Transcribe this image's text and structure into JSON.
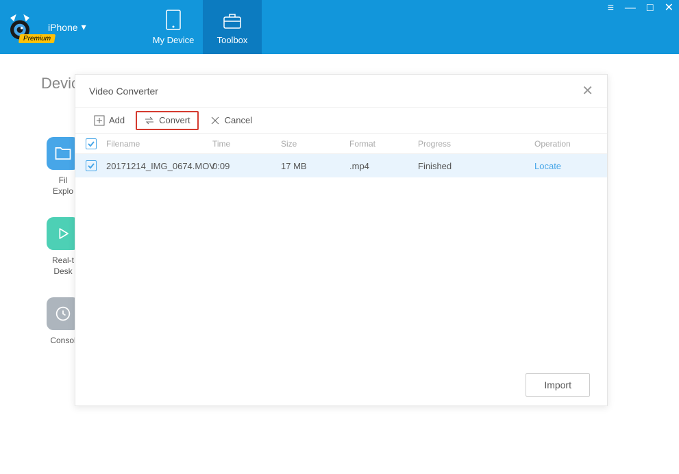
{
  "header": {
    "device_name": "iPhone",
    "premium_badge": "Premium",
    "tabs": [
      {
        "label": "My Device"
      },
      {
        "label": "Toolbox"
      }
    ]
  },
  "main": {
    "device_title": "Devic"
  },
  "shortcuts": [
    {
      "label": "Fil\nExplo"
    },
    {
      "label": "Real-t\nDesk"
    },
    {
      "label": "Consol"
    }
  ],
  "modal": {
    "title": "Video Converter",
    "toolbar": {
      "add": "Add",
      "convert": "Convert",
      "cancel": "Cancel"
    },
    "columns": {
      "filename": "Filename",
      "time": "Time",
      "size": "Size",
      "format": "Format",
      "progress": "Progress",
      "operation": "Operation"
    },
    "rows": [
      {
        "filename": "20171214_IMG_0674.MOV",
        "time": "0:09",
        "size": "17 MB",
        "format": ".mp4",
        "progress": "Finished",
        "operation": "Locate"
      }
    ],
    "footer": {
      "import": "Import"
    }
  }
}
